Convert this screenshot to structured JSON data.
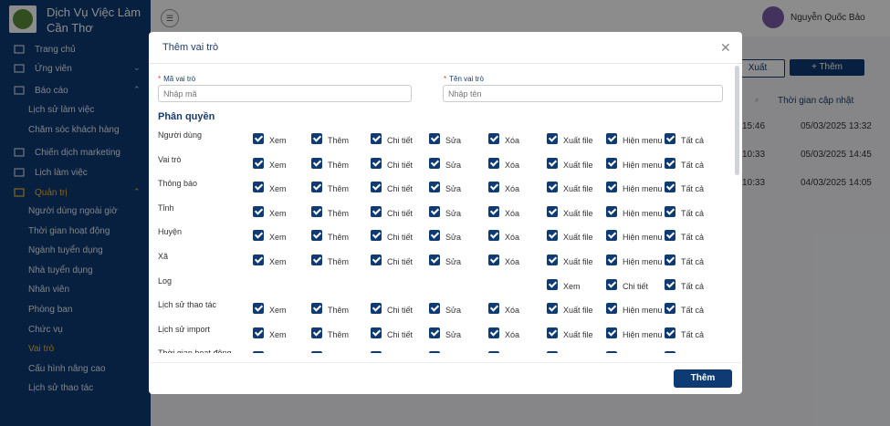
{
  "sidebar": {
    "brand_line1": "Dịch Vụ Việc Làm",
    "brand_line2": "Cần Thơ",
    "items": [
      {
        "label": "Trang chủ",
        "icon": "home-icon",
        "chevron": ""
      },
      {
        "label": "Ứng viên",
        "icon": "candidate-icon",
        "chevron": "⌄"
      },
      {
        "label": "Báo cáo",
        "icon": "list-icon",
        "chevron": "⌃"
      },
      {
        "label": "Chiến dịch marketing",
        "icon": "campaign-icon",
        "chevron": ""
      },
      {
        "label": "Lịch làm việc",
        "icon": "calendar-icon",
        "chevron": ""
      },
      {
        "label": "Quản trị",
        "icon": "admin-icon",
        "chevron": "⌃"
      }
    ],
    "report_sub": [
      "Lịch sử làm việc",
      "Chăm sóc khách hàng"
    ],
    "admin_sub": [
      "Người dùng ngoài giờ",
      "Thời gian hoạt động",
      "Ngành tuyển dụng",
      "Nhà tuyển dụng",
      "Nhân viên",
      "Phòng ban",
      "Chức vụ",
      "Vai trò",
      "Cấu hình nâng cao",
      "Lịch sử thao tác"
    ]
  },
  "header": {
    "user_name": "Nguyễn Quốc Bảo",
    "menu_icon": "hamburger-icon"
  },
  "background": {
    "export_label": "Xuất",
    "add_label": "+ Thêm",
    "col_header": "Thời gian cập nhật",
    "rows": [
      {
        "time_a": "15:46",
        "updated": "05/03/2025 13:32"
      },
      {
        "time_a": "10:33",
        "updated": "05/03/2025 14:45"
      },
      {
        "time_a": "10:33",
        "updated": "04/03/2025 14:05"
      }
    ]
  },
  "modal": {
    "title": "Thêm vai trò",
    "code_label": "Mã vai trò",
    "code_placeholder": "Nhập mã",
    "name_label": "Tên vai trò",
    "name_placeholder": "Nhập tên",
    "section": "Phân quyền",
    "submit": "Thêm",
    "accent": "#0e3b73",
    "perm_columns": [
      "Xem",
      "Thêm",
      "Chi tiết",
      "Sửa",
      "Xóa",
      "Xuất file",
      "Hiện menu",
      "Tất cả"
    ],
    "log_columns": [
      "Xem",
      "Chi tiết",
      "Tất cả"
    ],
    "rows": [
      {
        "name": "Người dùng",
        "type": "full",
        "checked": true
      },
      {
        "name": "Vai trò",
        "type": "full",
        "checked": true
      },
      {
        "name": "Thông báo",
        "type": "full",
        "checked": true
      },
      {
        "name": "Tỉnh",
        "type": "full",
        "checked": true
      },
      {
        "name": "Huyện",
        "type": "full",
        "checked": true
      },
      {
        "name": "Xã",
        "type": "full",
        "checked": true
      },
      {
        "name": "Log",
        "type": "log",
        "checked": true
      },
      {
        "name": "Lịch sử thao tác",
        "type": "full",
        "checked": true
      },
      {
        "name": "Lịch sử import",
        "type": "full",
        "checked": true
      },
      {
        "name": "Thời gian hoạt động",
        "type": "full",
        "checked": true
      }
    ]
  }
}
